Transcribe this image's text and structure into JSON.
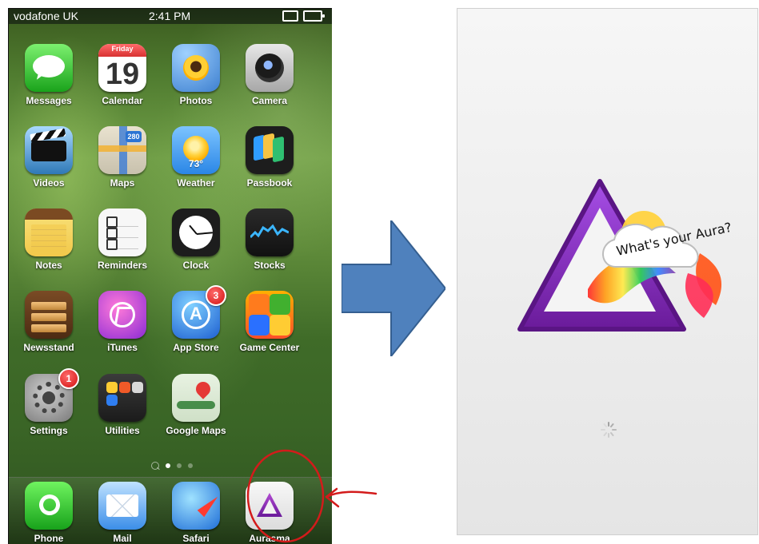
{
  "status_bar": {
    "carrier": "vodafone UK",
    "time": "2:41 PM"
  },
  "home_screen": {
    "apps": [
      {
        "label": "Messages",
        "icon": "messages-icon"
      },
      {
        "label": "Calendar",
        "icon": "calendar-icon",
        "calendar_day": "Friday",
        "calendar_date": "19"
      },
      {
        "label": "Photos",
        "icon": "photos-icon"
      },
      {
        "label": "Camera",
        "icon": "camera-icon"
      },
      {
        "label": "Videos",
        "icon": "videos-icon"
      },
      {
        "label": "Maps",
        "icon": "maps-icon",
        "map_sign": "280"
      },
      {
        "label": "Weather",
        "icon": "weather-icon",
        "temperature": "73°"
      },
      {
        "label": "Passbook",
        "icon": "passbook-icon"
      },
      {
        "label": "Notes",
        "icon": "notes-icon"
      },
      {
        "label": "Reminders",
        "icon": "reminders-icon"
      },
      {
        "label": "Clock",
        "icon": "clock-icon"
      },
      {
        "label": "Stocks",
        "icon": "stocks-icon"
      },
      {
        "label": "Newsstand",
        "icon": "newsstand-icon"
      },
      {
        "label": "iTunes",
        "icon": "itunes-icon"
      },
      {
        "label": "App Store",
        "icon": "app-store-icon",
        "badge": "3"
      },
      {
        "label": "Game Center",
        "icon": "game-center-icon"
      },
      {
        "label": "Settings",
        "icon": "settings-icon",
        "badge": "1"
      },
      {
        "label": "Utilities",
        "icon": "utilities-folder-icon"
      },
      {
        "label": "Google Maps",
        "icon": "google-maps-icon"
      }
    ],
    "dock": [
      {
        "label": "Phone",
        "icon": "phone-icon"
      },
      {
        "label": "Mail",
        "icon": "mail-icon"
      },
      {
        "label": "Safari",
        "icon": "safari-icon"
      },
      {
        "label": "Aurasma",
        "icon": "aurasma-icon"
      }
    ]
  },
  "splash": {
    "tagline": "What's your Aura?"
  },
  "colors": {
    "annotation_red": "#d31b1b",
    "arrow_blue": "#4f81bd",
    "aurasma_purple": "#8b3fb3"
  }
}
